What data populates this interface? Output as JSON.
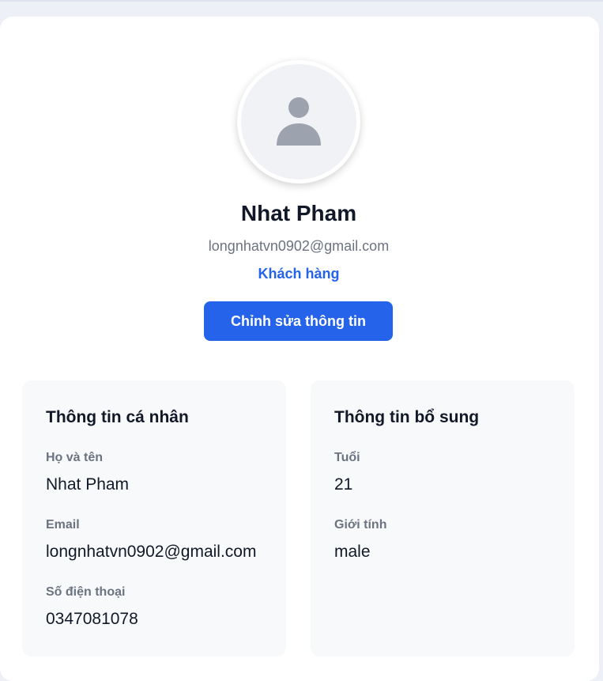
{
  "profile": {
    "name": "Nhat Pham",
    "email": "longnhatvn0902@gmail.com",
    "role": "Khách hàng",
    "edit_label": "Chỉnh sửa thông tin"
  },
  "personal": {
    "title": "Thông tin cá nhân",
    "fields": [
      {
        "label": "Họ và tên",
        "value": "Nhat Pham"
      },
      {
        "label": "Email",
        "value": "longnhatvn0902@gmail.com"
      },
      {
        "label": "Số điện thoại",
        "value": "0347081078"
      }
    ]
  },
  "additional": {
    "title": "Thông tin bổ sung",
    "fields": [
      {
        "label": "Tuổi",
        "value": "21"
      },
      {
        "label": "Giới tính",
        "value": "male"
      }
    ]
  },
  "icons": {
    "avatar": "user-icon"
  },
  "colors": {
    "accent": "#2563eb",
    "muted_text": "#6b7280",
    "panel_bg": "#f8f9fb"
  }
}
